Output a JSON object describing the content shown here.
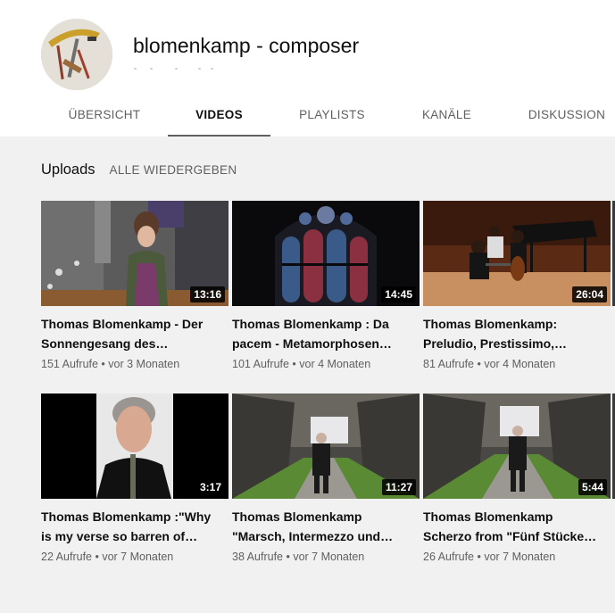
{
  "channel": {
    "name": "blomenkamp - composer"
  },
  "tabs": [
    {
      "label": "ÜBERSICHT"
    },
    {
      "label": "VIDEOS"
    },
    {
      "label": "PLAYLISTS"
    },
    {
      "label": "KANÄLE"
    },
    {
      "label": "DISKUSSION"
    }
  ],
  "active_tab": "VIDEOS",
  "section": {
    "title": "Uploads",
    "play_all": "ALLE WIEDERGEBEN"
  },
  "videos": [
    {
      "title_line1": "Thomas Blomenkamp - Der",
      "title_line2": "Sonnengesang des…",
      "duration": "13:16",
      "views": "151 Aufrufe",
      "age": "vor 3 Monaten"
    },
    {
      "title_line1": "Thomas Blomenkamp : Da",
      "title_line2": "pacem - Metamorphosen…",
      "duration": "14:45",
      "views": "101 Aufrufe",
      "age": "vor 4 Monaten"
    },
    {
      "title_line1": "Thomas Blomenkamp:",
      "title_line2": "Preludio, Prestissimo,…",
      "duration": "26:04",
      "views": "81 Aufrufe",
      "age": "vor 4 Monaten"
    },
    {
      "title_line1": "Thomas Blomenkamp :\"Why",
      "title_line2": "is my verse so barren of…",
      "duration": "3:17",
      "views": "22 Aufrufe",
      "age": "vor 7 Monaten"
    },
    {
      "title_line1": "Thomas Blomenkamp",
      "title_line2": "\"Marsch, Intermezzo und…",
      "duration": "11:27",
      "views": "38 Aufrufe",
      "age": "vor 7 Monaten"
    },
    {
      "title_line1": "Thomas Blomenkamp",
      "title_line2": "Scherzo from \"Fünf Stücke…",
      "duration": "5:44",
      "views": "26 Aufrufe",
      "age": "vor 7 Monaten"
    }
  ],
  "colors": {
    "page_bg": "#f1f1f1",
    "header_bg": "#ffffff",
    "text_primary": "#0f0f0f",
    "text_secondary": "#606060",
    "duration_badge": "#000000"
  }
}
